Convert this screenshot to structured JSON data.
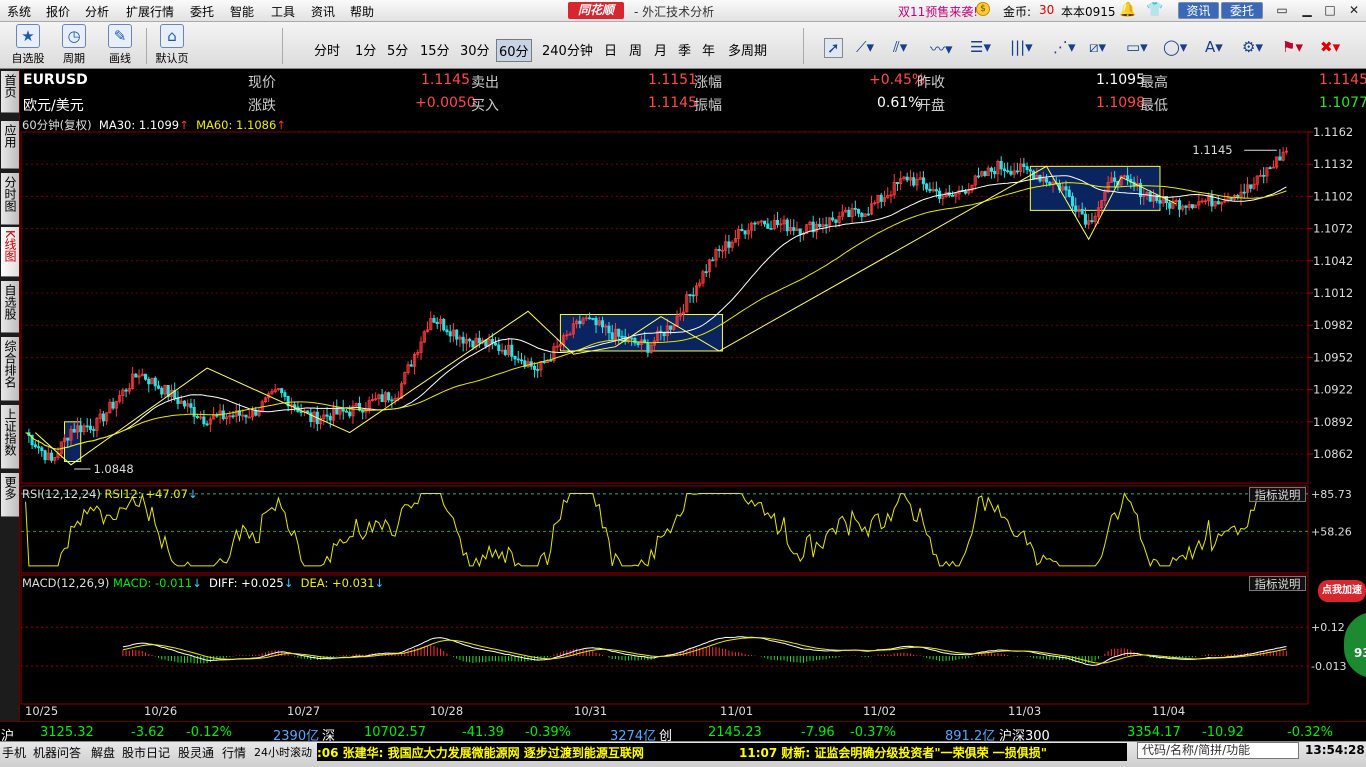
{
  "menu": [
    "系统",
    "报价",
    "分析",
    "扩展行情",
    "委托",
    "智能",
    "工具",
    "资讯",
    "帮助"
  ],
  "app": {
    "logo": "同花顺",
    "title": "- 外汇技术分析",
    "promo": "双11预售来袭!",
    "gold_label": "金币:",
    "gold_count": "30",
    "version": "本本0915",
    "news_button": "资讯",
    "trade_button": "委托"
  },
  "toolbar": {
    "big": [
      {
        "label": "自选股",
        "icon": "star-icon"
      },
      {
        "label": "周期",
        "icon": "clock-icon"
      },
      {
        "label": "画线",
        "icon": "pencil-icon"
      },
      {
        "label": "默认页",
        "icon": "home-icon"
      }
    ],
    "periods": [
      "分时",
      "1分",
      "5分",
      "15分",
      "30分",
      "60分",
      "240分钟",
      "日",
      "周",
      "月",
      "季",
      "年",
      "多周期"
    ],
    "active_period": "60分"
  },
  "side_tabs": [
    "首页",
    "应用",
    "分时图",
    "K线图",
    "自选股",
    "综合排名",
    "上证指数",
    "更多"
  ],
  "quote": {
    "code": "EURUSD",
    "name": "欧元/美元",
    "now_label": "现价",
    "now": "1.1145",
    "change_label": "涨跌",
    "change": "+0.0050",
    "sell_label": "卖出",
    "sell": "1.1151",
    "buy_label": "买入",
    "buy": "1.1145",
    "pct_label": "涨幅",
    "pct": "+0.45%",
    "amp_label": "振幅",
    "amp": "0.61%",
    "prev_label": "昨收",
    "prev": "1.1095",
    "open_label": "开盘",
    "open": "1.1098",
    "high_label": "最高",
    "high": "1.1145",
    "low_label": "最低",
    "low": "1.1077"
  },
  "main_indicator": {
    "period": "60分钟(复权)",
    "ma30": "MA30: 1.1099",
    "ma60": "MA60: 1.1086"
  },
  "rsi_indicator": {
    "label": "RSI(12,12,24)",
    "value": "RSI12: +47.07",
    "help": "指标说明"
  },
  "macd_indicator": {
    "label": "MACD(12,26,9)",
    "macd": "MACD: -0.011",
    "diff": "DIFF: +0.025",
    "dea": "DEA: +0.031",
    "help": "指标说明"
  },
  "chart_data": [
    {
      "type": "candlestick",
      "title": "EURUSD 60分钟",
      "y_ticks": [
        "1.1162",
        "1.1132",
        "1.1102",
        "1.1072",
        "1.1042",
        "1.1012",
        "1.0982",
        "1.0952",
        "1.0922",
        "1.0892",
        "1.0862"
      ],
      "ylim": [
        1.0835,
        1.1162
      ],
      "x_ticks": [
        "10/25",
        "10/26",
        "10/27",
        "10/28",
        "10/31",
        "11/01",
        "11/02",
        "11/03",
        "11/04"
      ],
      "annotations": [
        {
          "text": "1.0848",
          "value": 1.0848
        },
        {
          "text": "1.1145",
          "value": 1.1145
        }
      ],
      "series_names": [
        "MA30",
        "MA60"
      ],
      "colors": {
        "up": "#ff3b3b",
        "down": "#2fe0e0",
        "ma30": "#ffffff",
        "ma60": "#e8e800"
      }
    },
    {
      "type": "line",
      "title": "RSI",
      "y_ticks": [
        "+85.73",
        "+58.26"
      ],
      "ylim": [
        30,
        90
      ],
      "series_name": "RSI12"
    },
    {
      "type": "bar",
      "title": "MACD",
      "y_ticks": [
        "+0.12",
        "-0.013"
      ],
      "series_names": [
        "DIFF",
        "DEA"
      ]
    }
  ],
  "dates": [
    "10/25",
    "10/26",
    "10/27",
    "10/28",
    "10/31",
    "11/01",
    "11/02",
    "11/03",
    "11/04"
  ],
  "index_bar": [
    {
      "name": "沪",
      "value": "3125.32",
      "chg": "-3.62",
      "pct": "-0.12%",
      "vol": "2390亿"
    },
    {
      "name": "深",
      "value": "10702.57",
      "chg": "-41.39",
      "pct": "-0.39%",
      "vol": "3274亿"
    },
    {
      "name": "创",
      "value": "2145.23",
      "chg": "-7.96",
      "pct": "-0.37%",
      "vol": "891.2亿"
    },
    {
      "name": "沪深300",
      "value": "3354.17",
      "chg": "-10.92",
      "pct": "-0.32%",
      "vol": ""
    }
  ],
  "status": {
    "items": [
      "手机",
      "机器问答",
      "解盘",
      "股市日记",
      "股灵通",
      "行情",
      "24小时滚动"
    ],
    "ticker1": ":06 张建华: 我国应大力发展微能源网 逐步过渡到能源互联网",
    "ticker2": "11:07 财新: 证监会明确分级投资者\"一荣俱荣 一损俱损\"",
    "search_placeholder": "代码/名称/简拼/功能",
    "clock": "13:54:28",
    "add_badge": "点我加速",
    "speed_badge": "93"
  }
}
